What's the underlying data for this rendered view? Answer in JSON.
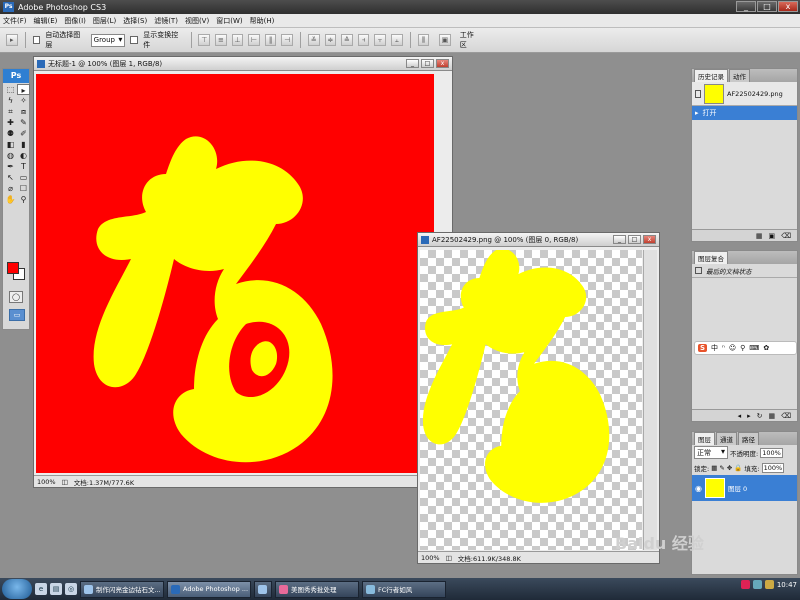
{
  "app": {
    "title": "Adobe Photoshop CS3",
    "window_controls": {
      "min": "_",
      "max": "□",
      "close": "x"
    }
  },
  "menu": [
    "文件(F)",
    "编辑(E)",
    "图像(I)",
    "图层(L)",
    "选择(S)",
    "滤镜(T)",
    "视图(V)",
    "窗口(W)",
    "帮助(H)"
  ],
  "options": {
    "auto_select_label": "自动选择图层",
    "auto_select_value": "Group",
    "show_transform_label": "显示变换控件",
    "workspace_label": "工作区"
  },
  "tools": {
    "logo": "Ps",
    "icons": [
      "marquee-icon",
      "move-icon",
      "lasso-icon",
      "magic-wand-icon",
      "crop-icon",
      "slice-icon",
      "healing-icon",
      "brush-icon",
      "stamp-icon",
      "history-brush-icon",
      "eraser-icon",
      "gradient-icon",
      "blur-icon",
      "dodge-icon",
      "pen-icon",
      "type-icon",
      "path-select-icon",
      "shape-icon",
      "eyedropper-icon",
      "notes-icon",
      "hand-icon",
      "zoom-icon"
    ],
    "glyphs": [
      "⬚",
      "▸",
      "ϟ",
      "✧",
      "⌗",
      "⧈",
      "✚",
      "✎",
      "⚉",
      "✐",
      "◧",
      "▮",
      "◍",
      "◐",
      "✒",
      "T",
      "↖",
      "▭",
      "⌀",
      "☐",
      "✋",
      "⚲"
    ],
    "foreground_color": "#ff0000",
    "background_color": "#ffffff"
  },
  "doc1": {
    "title": "无标题-1 @ 100% (图层 1, RGB/8)",
    "zoom": "100%",
    "status": "文档:1.37M/777.6K",
    "canvas_color": "#ff0000",
    "glyph_color": "#ffff00"
  },
  "doc2": {
    "title": "AF22502429.png @ 100% (图层 0, RGB/8)",
    "zoom": "100%",
    "status": "文档:611.9K/348.8K",
    "glyph_color": "#ffff00"
  },
  "history_panel": {
    "tabs": [
      "历史记录",
      "动作"
    ],
    "snapshot": "AF22502429.png",
    "items": [
      "打开"
    ]
  },
  "layer_comps_panel": {
    "tabs": [
      "图层复合"
    ],
    "items": [
      "最后的文档状态"
    ]
  },
  "layers_panel": {
    "tabs": [
      "图层",
      "通道",
      "路径"
    ],
    "blend_mode": "正常",
    "opacity_label": "不透明度:",
    "opacity_value": "100%",
    "lock_label": "锁定:",
    "fill_label": "填充:",
    "fill_value": "100%",
    "layers": [
      "图层 0"
    ]
  },
  "taskbar": {
    "tasks": [
      "制作闪亮金边钻石文...",
      "Adobe Photoshop ...",
      "",
      "美图秀秀批处理",
      "FC行者如风"
    ],
    "clock": "10:47"
  },
  "watermark": "Baidu 经验"
}
